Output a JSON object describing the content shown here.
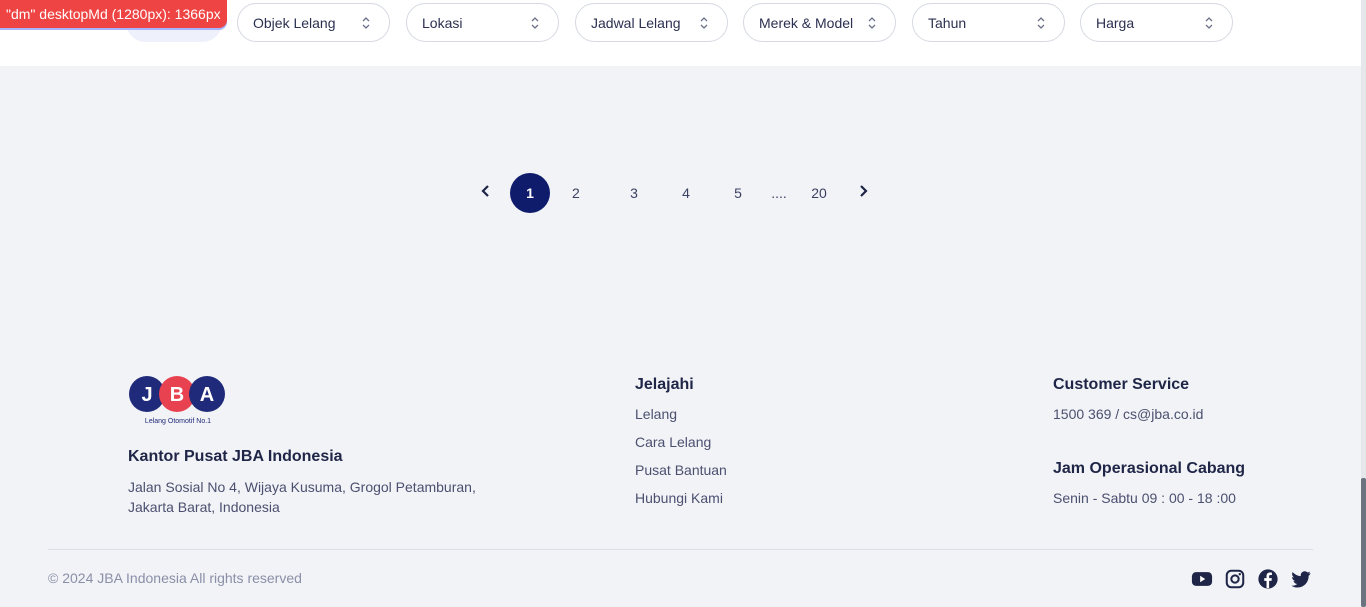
{
  "debug_badge": "\"dm\" desktopMd (1280px): 1366px",
  "filters": [
    {
      "label": "Objek Lelang",
      "icon": "chevron-updown-icon"
    },
    {
      "label": "Lokasi",
      "icon": "chevron-updown-icon"
    },
    {
      "label": "Jadwal Lelang",
      "icon": "chevron-updown-icon"
    },
    {
      "label": "Merek & Model",
      "icon": "chevron-updown-icon"
    },
    {
      "label": "Tahun",
      "icon": "chevron-updown-icon"
    },
    {
      "label": "Harga",
      "icon": "chevron-updown-icon"
    }
  ],
  "pagination": {
    "current": "1",
    "pages": [
      "1",
      "2",
      "3",
      "4",
      "5",
      "....",
      "20"
    ],
    "prev_icon": "chevron-left-icon",
    "next_icon": "chevron-right-icon"
  },
  "footer": {
    "logo": {
      "letters": [
        "J",
        "B",
        "A"
      ],
      "tagline": "Lelang Otomotif No.1",
      "colors": [
        "#1f2a7a",
        "#e8414f",
        "#1f2a7a"
      ]
    },
    "hq_title": "Kantor Pusat JBA Indonesia",
    "hq_address": "Jalan Sosial No 4, Wijaya Kusuma, Grogol Petamburan, Jakarta Barat, Indonesia",
    "explore": {
      "title": "Jelajahi",
      "links": [
        "Lelang",
        "Cara Lelang",
        "Pusat Bantuan",
        "Hubungi Kami"
      ]
    },
    "customer_service": {
      "title": "Customer Service",
      "contact": "1500 369 / cs@jba.co.id"
    },
    "branch_hours": {
      "title": "Jam Operasional Cabang",
      "hours": "Senin - Sabtu 09 : 00 - 18 :00"
    },
    "copyright": "© 2024 JBA Indonesia All rights reserved",
    "social": [
      "youtube-icon",
      "instagram-icon",
      "facebook-icon",
      "twitter-icon"
    ]
  },
  "colors": {
    "primary": "#0e1c6b",
    "accent_red": "#e8414f",
    "background": "#f2f3f6"
  }
}
